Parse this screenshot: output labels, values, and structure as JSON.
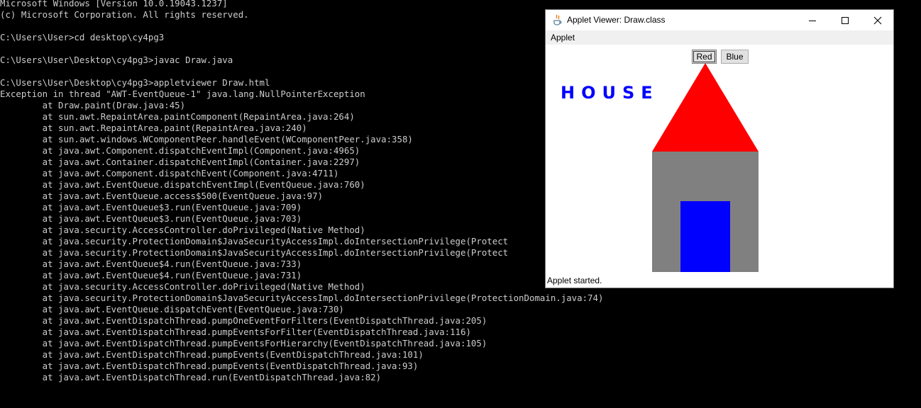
{
  "console": {
    "lines": [
      "Microsoft Windows [Version 10.0.19043.1237]",
      "(c) Microsoft Corporation. All rights reserved.",
      "",
      "C:\\Users\\User>cd desktop\\cy4pg3",
      "",
      "C:\\Users\\User\\Desktop\\cy4pg3>javac Draw.java",
      "",
      "C:\\Users\\User\\Desktop\\cy4pg3>appletviewer Draw.html",
      "Exception in thread \"AWT-EventQueue-1\" java.lang.NullPointerException",
      "        at Draw.paint(Draw.java:45)",
      "        at sun.awt.RepaintArea.paintComponent(RepaintArea.java:264)",
      "        at sun.awt.RepaintArea.paint(RepaintArea.java:240)",
      "        at sun.awt.windows.WComponentPeer.handleEvent(WComponentPeer.java:358)",
      "        at java.awt.Component.dispatchEventImpl(Component.java:4965)",
      "        at java.awt.Container.dispatchEventImpl(Container.java:2297)",
      "        at java.awt.Component.dispatchEvent(Component.java:4711)",
      "        at java.awt.EventQueue.dispatchEventImpl(EventQueue.java:760)",
      "        at java.awt.EventQueue.access$500(EventQueue.java:97)",
      "        at java.awt.EventQueue$3.run(EventQueue.java:709)",
      "        at java.awt.EventQueue$3.run(EventQueue.java:703)",
      "        at java.security.AccessController.doPrivileged(Native Method)",
      "        at java.security.ProtectionDomain$JavaSecurityAccessImpl.doIntersectionPrivilege(Protect",
      "        at java.security.ProtectionDomain$JavaSecurityAccessImpl.doIntersectionPrivilege(Protect",
      "        at java.awt.EventQueue$4.run(EventQueue.java:733)",
      "        at java.awt.EventQueue$4.run(EventQueue.java:731)",
      "        at java.security.AccessController.doPrivileged(Native Method)",
      "        at java.security.ProtectionDomain$JavaSecurityAccessImpl.doIntersectionPrivilege(ProtectionDomain.java:74)",
      "        at java.awt.EventQueue.dispatchEvent(EventQueue.java:730)",
      "        at java.awt.EventDispatchThread.pumpOneEventForFilters(EventDispatchThread.java:205)",
      "        at java.awt.EventDispatchThread.pumpEventsForFilter(EventDispatchThread.java:116)",
      "        at java.awt.EventDispatchThread.pumpEventsForHierarchy(EventDispatchThread.java:105)",
      "        at java.awt.EventDispatchThread.pumpEvents(EventDispatchThread.java:101)",
      "        at java.awt.EventDispatchThread.pumpEvents(EventDispatchThread.java:93)",
      "        at java.awt.EventDispatchThread.run(EventDispatchThread.java:82)"
    ]
  },
  "applet_window": {
    "title": "Applet Viewer: Draw.class",
    "icon": "java-icon",
    "controls": {
      "minimize": "minimize-icon",
      "maximize": "maximize-icon",
      "close": "close-icon"
    },
    "menu": [
      "Applet"
    ],
    "buttons": {
      "red_label": "Red",
      "blue_label": "Blue"
    },
    "drawing": {
      "label": "HOUSE",
      "label_color": "#0000ff",
      "roof_color": "#ff0000",
      "wall_color": "#808080",
      "door_color": "#0000ff"
    },
    "status": "Applet started."
  },
  "colors": {
    "console_background": "#000000",
    "console_text": "#cccccc"
  }
}
